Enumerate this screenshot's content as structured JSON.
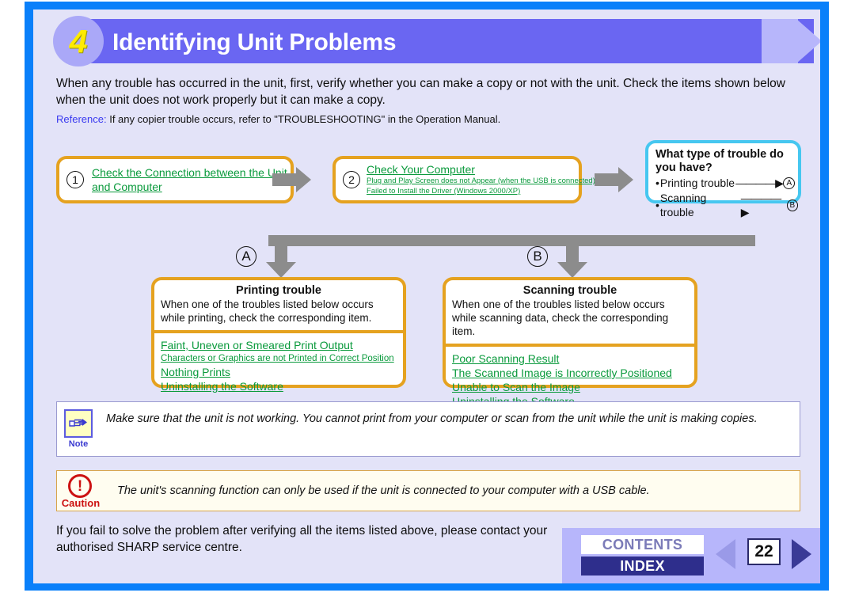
{
  "header": {
    "step_number": "4",
    "title": "Identifying Unit Problems"
  },
  "intro": {
    "paragraph": "When any trouble has occurred in the unit, first, verify whether you can make a copy or not with the unit. Check the items shown below when the unit does not work properly but it can make a copy.",
    "reference_label": "Reference:",
    "reference_text": " If any copier trouble occurs, refer to \"TROUBLESHOOTING\" in the Operation Manual."
  },
  "flow": {
    "step1": {
      "marker": "1",
      "link": "Check the Connection between the Unit and Computer"
    },
    "step2": {
      "marker": "2",
      "link_main": "Check Your Computer",
      "link_sub1": "Plug and Play Screen does not Appear (when the USB is connected)",
      "link_sub2": "Failed to Install the Driver (Windows 2000/XP)"
    },
    "step3": {
      "heading": "What type of trouble do you have?",
      "rows": [
        {
          "bullet": "•",
          "label": "Printing trouble",
          "dash": "————▶",
          "target": "A"
        },
        {
          "bullet": "•",
          "label": "Scanning trouble",
          "dash": "————▶",
          "target": "B"
        }
      ]
    },
    "branch_a_marker": "A",
    "branch_b_marker": "B"
  },
  "trouble_left": {
    "heading": "Printing trouble",
    "description": "When one of the troubles listed below occurs while printing, check the corresponding item.",
    "links": [
      {
        "text": "Faint, Uneven or Smeared Print Output",
        "size": "big"
      },
      {
        "text": "Characters or Graphics are not Printed in Correct Position",
        "size": "sm"
      },
      {
        "text": "Nothing Prints",
        "size": "big"
      },
      {
        "text": "Uninstalling the Software",
        "size": "big"
      }
    ]
  },
  "trouble_right": {
    "heading": "Scanning trouble",
    "description": "When one of the troubles listed below occurs while scanning data, check the corresponding item.",
    "links": [
      {
        "text": "Poor Scanning Result",
        "size": "big"
      },
      {
        "text": "The Scanned Image is Incorrectly Positioned",
        "size": "big"
      },
      {
        "text": "Unable to Scan the Image",
        "size": "big"
      },
      {
        "text": "Uninstalling the Software",
        "size": "big"
      }
    ]
  },
  "note": {
    "label": "Note",
    "icon": "pointing-hand-icon",
    "text": "Make sure that the unit is not working. You cannot print from your computer or scan from the unit while the unit is making copies."
  },
  "caution": {
    "label": "Caution",
    "icon": "exclamation-circle-icon",
    "glyph": "!",
    "text": "The unit's scanning function can only be used if the unit is connected to your computer with a USB cable."
  },
  "footer": {
    "text": "If you fail to solve the problem after verifying all the items listed above, please contact your authorised SHARP service centre.",
    "contents_label": "CONTENTS",
    "index_label": "INDEX",
    "page_number": "22",
    "prev_icon": "triangle-left-icon",
    "next_icon": "triangle-right-icon"
  },
  "colors": {
    "frame_blue": "#0a80fa",
    "page_bg": "#e3e3f8",
    "header_purple": "#6a66f2",
    "header_arrow": "#b7b6fb",
    "step_number_yellow": "#ffeb00",
    "box_orange": "#e5a220",
    "box_cyan": "#46c7f0",
    "link_green": "#0a9a3c",
    "arrow_gray": "#8c8c8c",
    "reference_blue": "#3a3af0",
    "caution_red": "#cc1111",
    "note_border_blue": "#5c5ce0",
    "note_icon_bg": "#ffffc2",
    "footer_band": "#b7b6fb",
    "index_navy": "#2e2e8c"
  }
}
